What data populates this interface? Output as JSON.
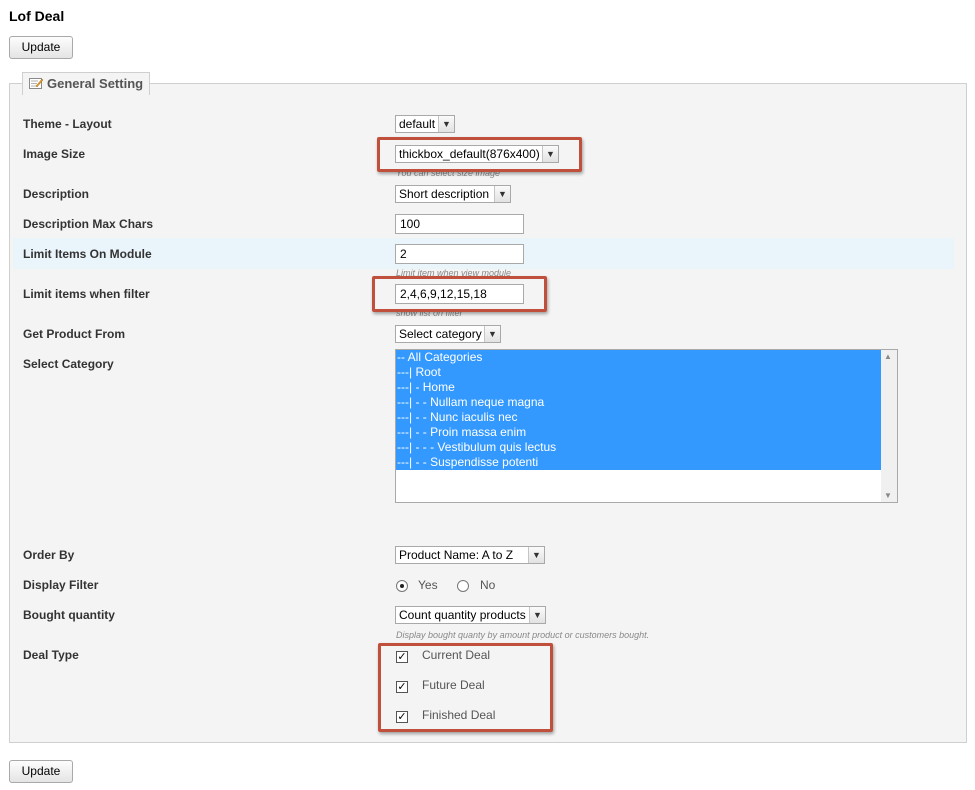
{
  "page": {
    "title": "Lof Deal",
    "update_label": "Update",
    "accent_color": "#3399ff",
    "highlight_color": "#c0503c"
  },
  "section": {
    "legend": "General Setting",
    "legend_icon": "edit-icon"
  },
  "fields": {
    "theme_layout": {
      "label": "Theme - Layout",
      "value": "default"
    },
    "image_size": {
      "label": "Image Size",
      "value": "thickbox_default(876x400)",
      "hint": "You can select size image"
    },
    "description": {
      "label": "Description",
      "value": "Short description"
    },
    "description_max_chars": {
      "label": "Description Max Chars",
      "value": "100"
    },
    "limit_items_module": {
      "label": "Limit Items On Module",
      "value": "2",
      "hint": "Limit item when view module"
    },
    "limit_items_filter": {
      "label": "Limit items when filter",
      "value": "2,4,6,9,12,15,18",
      "hint": "show list on filter"
    },
    "get_product_from": {
      "label": "Get Product From",
      "value": "Select category"
    },
    "select_category": {
      "label": "Select Category",
      "options": [
        "-- All Categories",
        "---| Root",
        "---| - Home",
        "---| - - Nullam neque magna",
        "---| - - Nunc iaculis nec",
        "---| - - Proin massa enim",
        "---| - - - Vestibulum quis lectus",
        "---| - - Suspendisse potenti"
      ]
    },
    "order_by": {
      "label": "Order By",
      "value": "Product Name: A to Z"
    },
    "display_filter": {
      "label": "Display Filter",
      "yes": "Yes",
      "no": "No",
      "selected": "Yes"
    },
    "bought_quantity": {
      "label": "Bought quantity",
      "value": "Count quantity products",
      "hint": "Display bought quanty by amount product or customers bought."
    },
    "deal_type": {
      "label": "Deal Type",
      "options": [
        {
          "label": "Current Deal",
          "checked": true
        },
        {
          "label": "Future Deal",
          "checked": true
        },
        {
          "label": "Finished Deal",
          "checked": true
        }
      ]
    }
  }
}
